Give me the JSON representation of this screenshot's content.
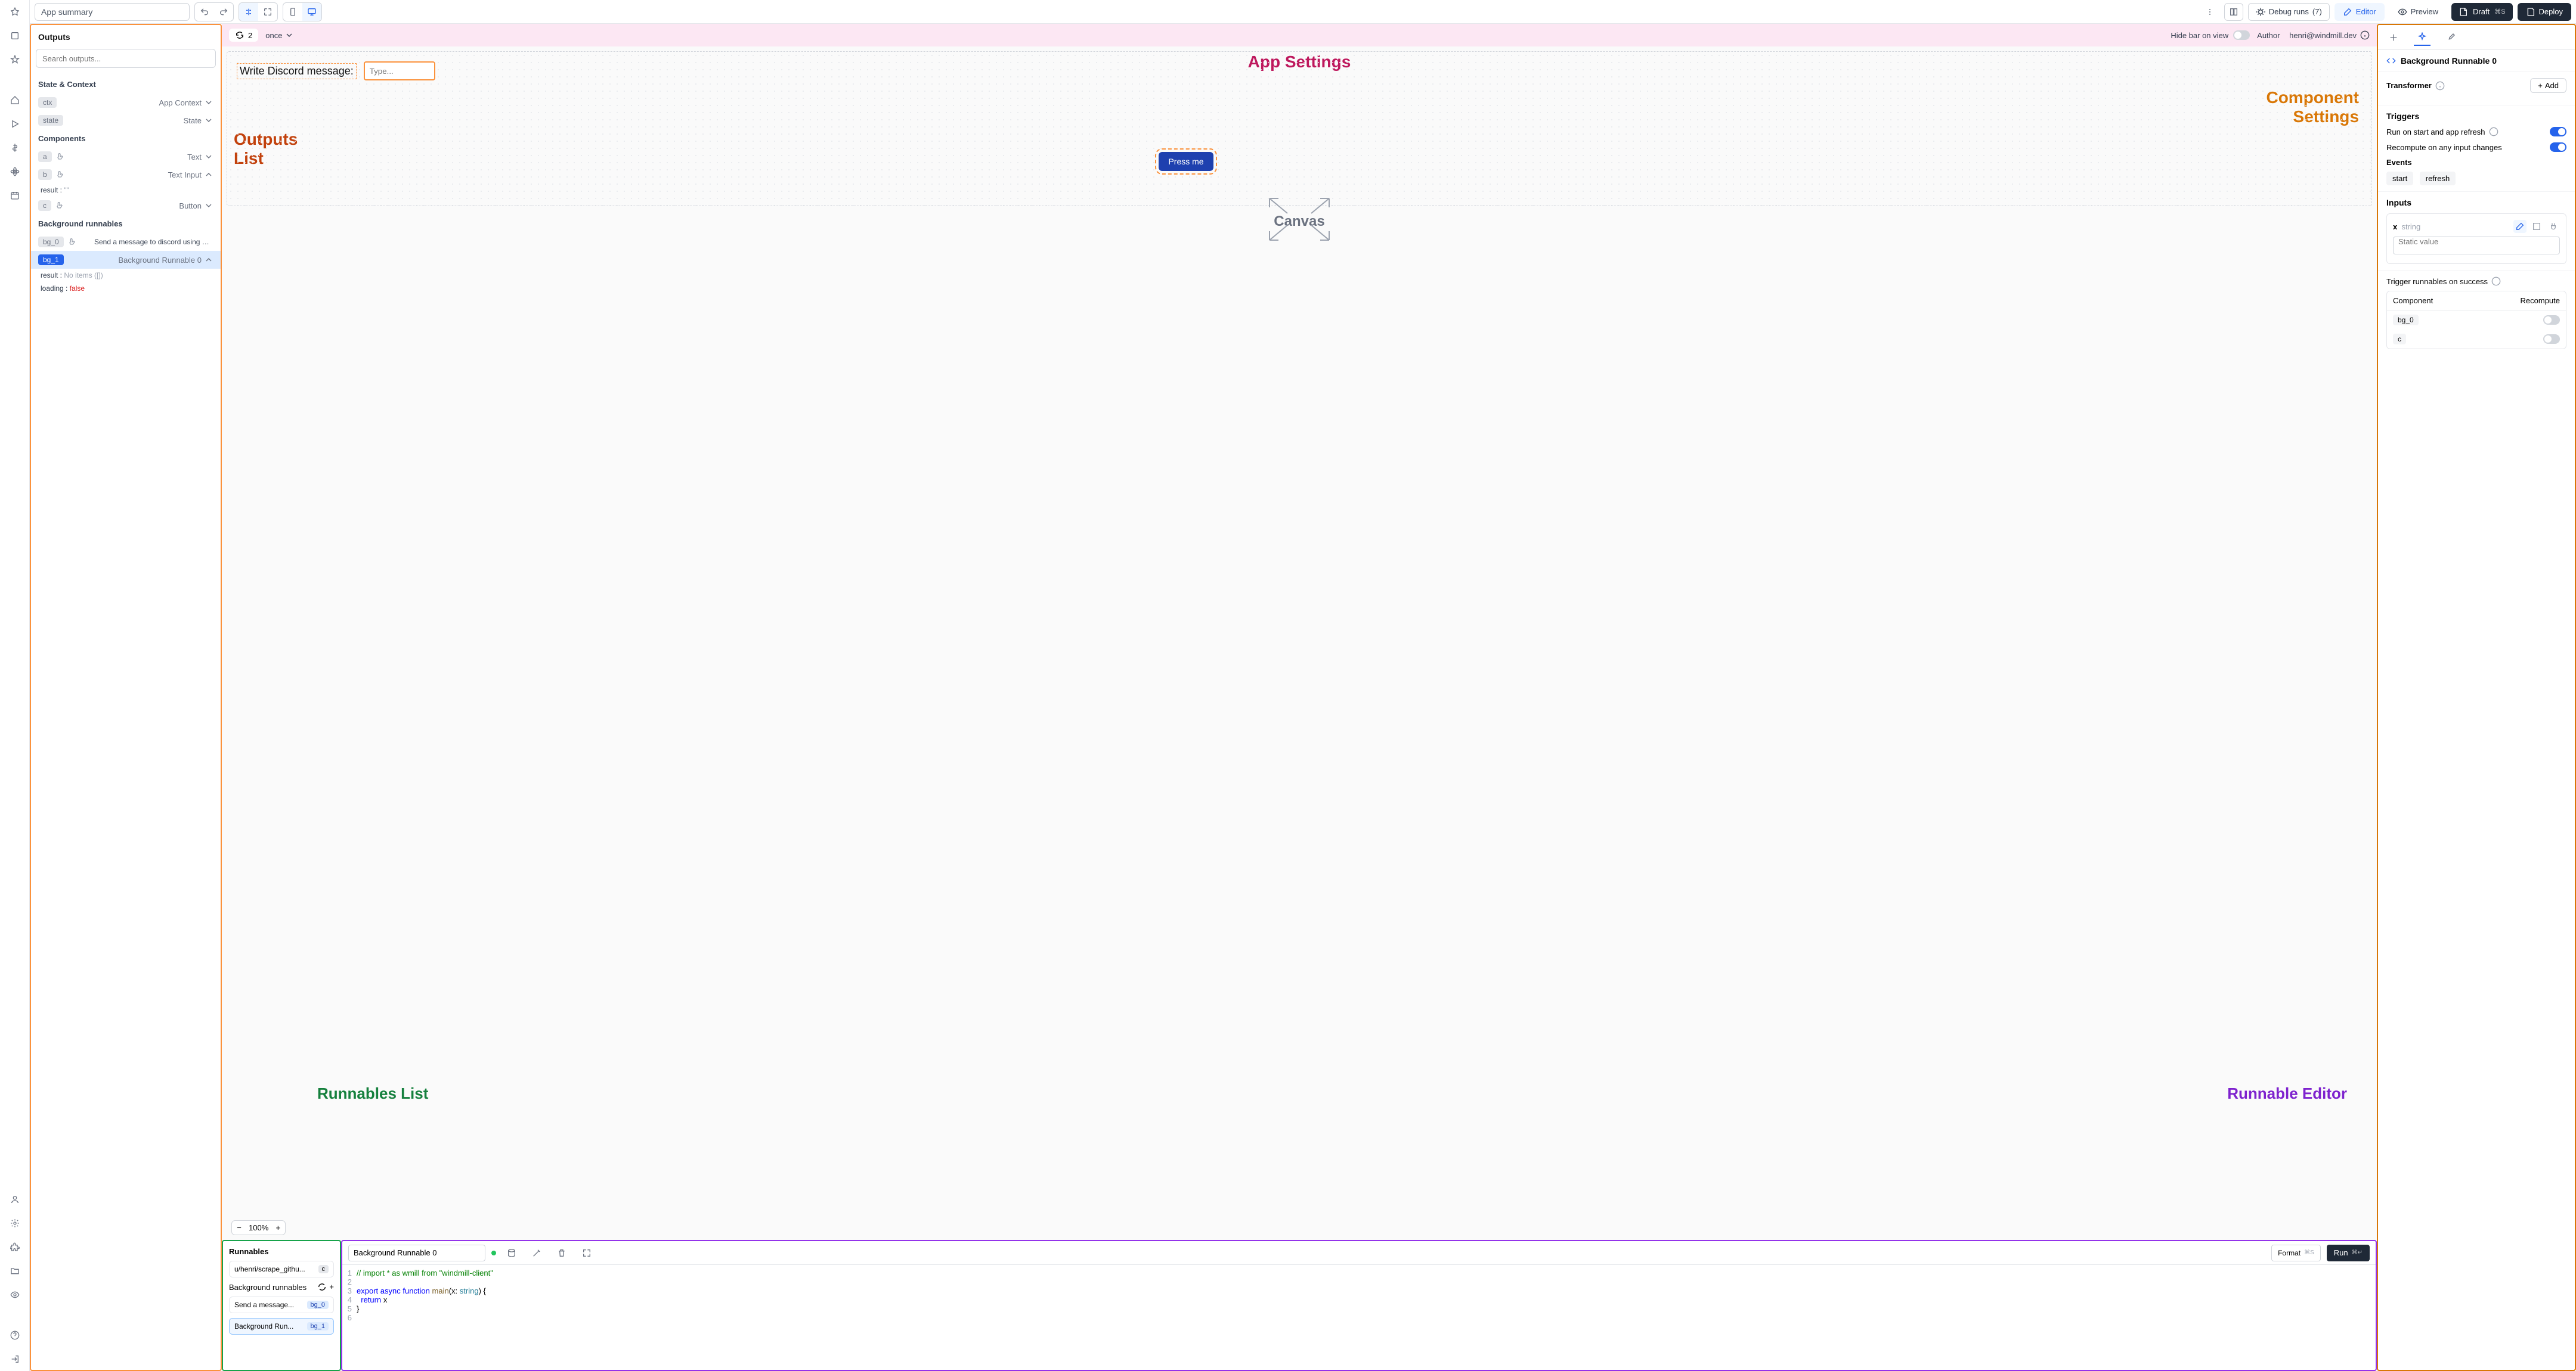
{
  "topbar": {
    "summary": "App summary",
    "debug": "Debug runs",
    "debug_count": "(7)",
    "editor": "Editor",
    "preview": "Preview",
    "draft": "Draft",
    "draft_kbd": "⌘S",
    "deploy": "Deploy"
  },
  "canvasbar": {
    "run_count": "2",
    "mode": "once",
    "hide_bar": "Hide bar on view",
    "author_label": "Author",
    "author": "henri@windmill.dev"
  },
  "overlays": {
    "app_settings": "App Settings",
    "component_settings": "Component\nSettings",
    "outputs_list": "Outputs\nList",
    "canvas": "Canvas",
    "runnables_list": "Runnables List",
    "runnable_editor": "Runnable Editor"
  },
  "outputs": {
    "title": "Outputs",
    "search_ph": "Search outputs...",
    "sections": {
      "state": "State & Context",
      "components": "Components",
      "bg": "Background runnables"
    },
    "ctx": {
      "badge": "ctx",
      "label": "App Context"
    },
    "state": {
      "badge": "state",
      "label": "State"
    },
    "a": {
      "badge": "a",
      "label": "Text"
    },
    "b": {
      "badge": "b",
      "label": "Text Input"
    },
    "b_result_key": "result",
    "b_result_val": "\"\"",
    "c": {
      "badge": "c",
      "label": "Button"
    },
    "bg0": {
      "badge": "bg_0",
      "label": "Send a message to discord using webhoo"
    },
    "bg1": {
      "badge": "bg_1",
      "label": "Background Runnable 0"
    },
    "bg1_result_key": "result",
    "bg1_result_val": "No items ([])",
    "bg1_loading_key": "loading",
    "bg1_loading_val": "false"
  },
  "canvas": {
    "form_label": "Write Discord message:",
    "form_ph": "Type...",
    "press": "Press me",
    "zoom": "100%"
  },
  "runnables": {
    "title": "Runnables",
    "bg_title": "Background runnables",
    "item1": {
      "label": "u/henri/scrape_githu...",
      "badge": "c"
    },
    "item2": {
      "label": "Send a message...",
      "badge": "bg_0"
    },
    "item3": {
      "label": "Background Run...",
      "badge": "bg_1"
    }
  },
  "editor": {
    "name": "Background Runnable 0",
    "format": "Format",
    "format_kbd": "⌘S",
    "run": "Run",
    "run_kbd": "⌘↵",
    "code": {
      "l1": "// import * as wmill from \"windmill-client\"",
      "l3a": "export",
      "l3b": "async",
      "l3c": "function",
      "l3d": "main",
      "l3e": "(x:",
      "l3f": "string",
      "l3g": ") {",
      "l4a": "return",
      "l4b": "x",
      "l5": "}"
    }
  },
  "right": {
    "header": "Background Runnable 0",
    "transformer": "Transformer",
    "add": "Add",
    "triggers": "Triggers",
    "trig1": "Run on start and app refresh",
    "trig2": "Recompute on any input changes",
    "events": "Events",
    "ev_start": "start",
    "ev_refresh": "refresh",
    "inputs": "Inputs",
    "input_name": "x",
    "input_type": "string",
    "static_ph": "Static value",
    "trig_success": "Trigger runnables on success",
    "col_comp": "Component",
    "col_recomp": "Recompute",
    "row1": "bg_0",
    "row2": "c"
  }
}
